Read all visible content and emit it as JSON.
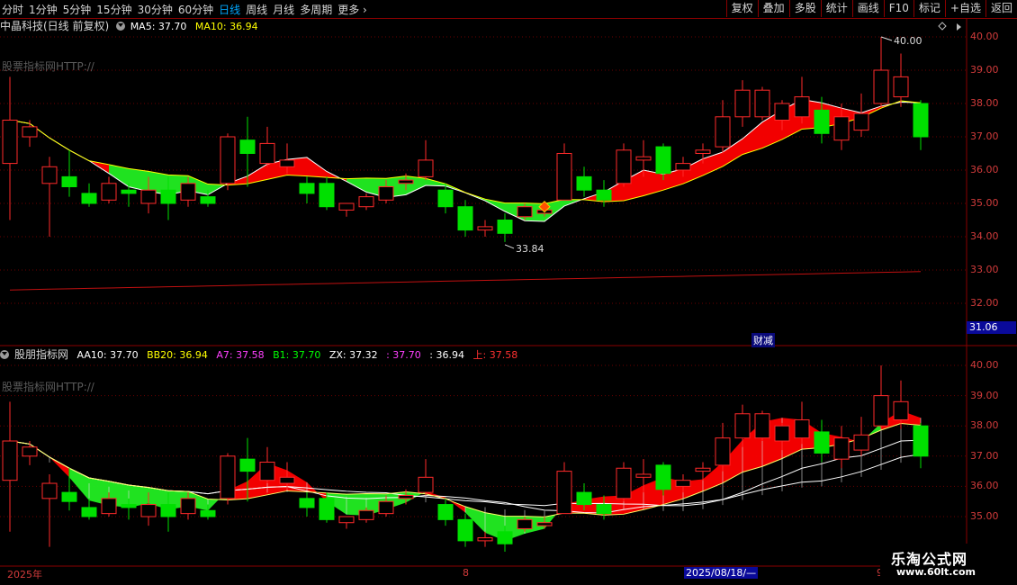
{
  "toolbar": {
    "left_items": [
      "分时",
      "1分钟",
      "5分钟",
      "15分钟",
      "30分钟",
      "60分钟",
      "日线",
      "周线",
      "月线",
      "多周期",
      "更多"
    ],
    "active": "日线",
    "right_items": [
      "复权",
      "叠加",
      "多股",
      "统计",
      "画线",
      "F10",
      "标记",
      "+自选",
      "返回"
    ]
  },
  "main": {
    "title": "中晶科技(日线 前复权)",
    "ma5": "MA5: 37.70",
    "ma10": "MA10: 36.94",
    "watermark": "股票指标网HTTP://",
    "high_label": "40.00",
    "low_label": "33.84",
    "axis_ticks": [
      "40.00",
      "39.00",
      "38.00",
      "37.00",
      "36.00",
      "35.00",
      "34.00",
      "33.00",
      "32.00"
    ],
    "price_box": "31.06",
    "caijian": "财减"
  },
  "sub": {
    "title": "股朋指标网",
    "aa10": "AA10: 37.70",
    "bb20": "BB20: 36.94",
    "a7": "A7: 37.58",
    "b1": "B1: 37.70",
    "zx": "ZX: 37.32",
    "v1": ": 37.70",
    "v2": ": 36.94",
    "up": "上: 37.58",
    "watermark": "股票指标网HTTP://",
    "axis_ticks": [
      "40.00",
      "39.00",
      "38.00",
      "37.00",
      "36.00",
      "35.00"
    ]
  },
  "dates": {
    "y2025": "2025年",
    "m8": "8",
    "cursor": "2025/08/18/—",
    "end": "9"
  },
  "logo": {
    "title": "乐淘公式网",
    "url": "www.60lt.com"
  },
  "colors": {
    "up": "#ff2a2a",
    "down": "#00e000",
    "ma5": "#ffffff",
    "ma10": "#ffff00",
    "band_up": "#ff0000",
    "band_down": "#22ee22"
  },
  "chart_data": {
    "type": "candlestick",
    "candles": [
      [
        36.2,
        37.5,
        38.8,
        34.5
      ],
      [
        37.0,
        37.3,
        37.5,
        36.7
      ],
      [
        35.6,
        36.1,
        36.4,
        34.0
      ],
      [
        35.8,
        35.5,
        36.6,
        35.2
      ],
      [
        35.3,
        35.0,
        35.6,
        34.9
      ],
      [
        35.1,
        35.6,
        35.8,
        35.0
      ],
      [
        35.4,
        35.3,
        35.6,
        34.9
      ],
      [
        35.0,
        35.4,
        35.8,
        34.7
      ],
      [
        35.4,
        35.0,
        35.8,
        34.5
      ],
      [
        35.1,
        35.6,
        35.8,
        34.9
      ],
      [
        35.2,
        35.0,
        35.4,
        34.9
      ],
      [
        35.6,
        37.0,
        37.1,
        35.4
      ],
      [
        36.9,
        36.5,
        37.6,
        35.5
      ],
      [
        36.2,
        36.8,
        37.3,
        36.1
      ],
      [
        36.1,
        36.3,
        36.8,
        35.9
      ],
      [
        35.6,
        35.3,
        35.8,
        35.0
      ],
      [
        35.6,
        34.9,
        35.8,
        34.8
      ],
      [
        34.8,
        35.0,
        35.0,
        34.6
      ],
      [
        34.9,
        35.2,
        35.3,
        34.8
      ],
      [
        35.1,
        35.5,
        35.7,
        35.0
      ],
      [
        35.6,
        35.7,
        35.9,
        35.4
      ],
      [
        35.8,
        36.3,
        36.9,
        35.7
      ],
      [
        35.4,
        34.9,
        35.6,
        34.7
      ],
      [
        34.9,
        34.2,
        35.1,
        34.0
      ],
      [
        34.2,
        34.3,
        34.5,
        34.0
      ],
      [
        34.5,
        34.1,
        34.7,
        33.84
      ],
      [
        34.6,
        34.9,
        35.0,
        34.5
      ],
      [
        34.7,
        34.8,
        35.0,
        34.6
      ],
      [
        35.1,
        36.5,
        36.8,
        35.1
      ],
      [
        35.8,
        35.4,
        36.1,
        35.2
      ],
      [
        35.4,
        35.1,
        35.7,
        34.9
      ],
      [
        35.6,
        36.6,
        36.8,
        35.5
      ],
      [
        36.3,
        36.4,
        36.9,
        35.8
      ],
      [
        36.7,
        35.9,
        36.8,
        35.7
      ],
      [
        36.0,
        36.2,
        36.4,
        35.8
      ],
      [
        36.5,
        36.6,
        36.8,
        36.2
      ],
      [
        36.7,
        37.6,
        38.1,
        36.5
      ],
      [
        37.6,
        38.4,
        38.7,
        37.3
      ],
      [
        37.6,
        38.4,
        38.5,
        37.5
      ],
      [
        37.5,
        38.0,
        38.1,
        37.2
      ],
      [
        37.6,
        38.2,
        38.8,
        37.4
      ],
      [
        37.8,
        37.1,
        38.2,
        36.8
      ],
      [
        36.9,
        37.6,
        38.0,
        36.6
      ],
      [
        37.2,
        37.7,
        38.3,
        37.0
      ],
      [
        38.0,
        39.0,
        40.0,
        37.9
      ],
      [
        38.2,
        38.8,
        39.5,
        37.9
      ],
      [
        38.0,
        37.0,
        38.1,
        36.6
      ]
    ]
  }
}
